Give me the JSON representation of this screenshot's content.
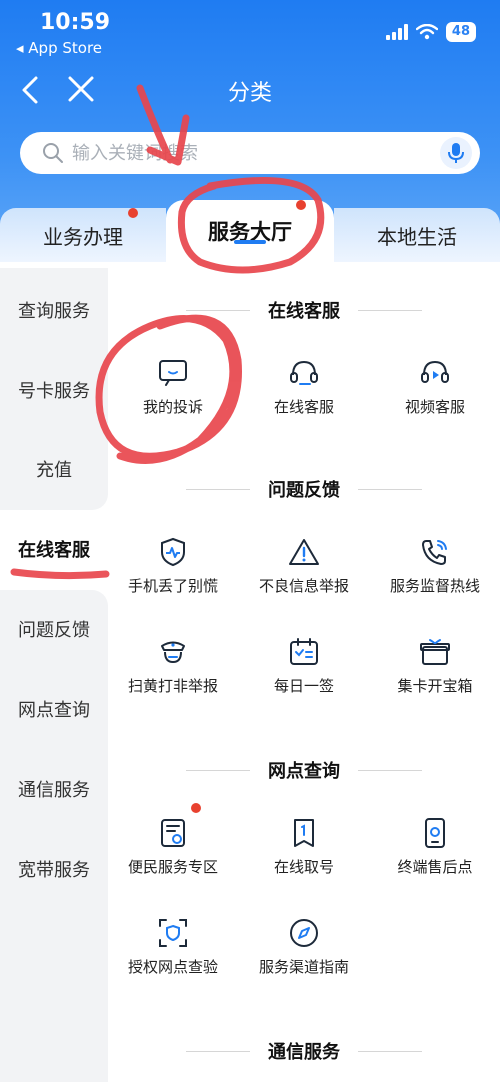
{
  "status_bar": {
    "time": "10:59",
    "back_app": "◂ App Store",
    "battery": "48"
  },
  "nav": {
    "title": "分类"
  },
  "search": {
    "placeholder": "输入关键词搜索"
  },
  "tabs": [
    {
      "label": "业务办理"
    },
    {
      "label": "服务大厅"
    },
    {
      "label": "本地生活"
    }
  ],
  "sidebar": {
    "items": [
      {
        "label": "查询服务"
      },
      {
        "label": "号卡服务"
      },
      {
        "label": "充值"
      },
      {
        "label": "在线客服"
      },
      {
        "label": "问题反馈"
      },
      {
        "label": "网点查询"
      },
      {
        "label": "通信服务"
      },
      {
        "label": "宽带服务"
      }
    ]
  },
  "sections": [
    {
      "title": "在线客服",
      "items": [
        {
          "label": "我的投诉",
          "icon": "chat-bubble-icon"
        },
        {
          "label": "在线客服",
          "icon": "headset-icon"
        },
        {
          "label": "视频客服",
          "icon": "video-headset-icon"
        }
      ]
    },
    {
      "title": "问题反馈",
      "items": [
        {
          "label": "手机丢了别慌",
          "icon": "shield-pulse-icon"
        },
        {
          "label": "不良信息举报",
          "icon": "warning-icon"
        },
        {
          "label": "服务监督热线",
          "icon": "phone-call-icon"
        },
        {
          "label": "扫黄打非举报",
          "icon": "police-icon"
        },
        {
          "label": "每日一签",
          "icon": "calendar-check-icon"
        },
        {
          "label": "集卡开宝箱",
          "icon": "gift-box-icon"
        }
      ]
    },
    {
      "title": "网点查询",
      "items": [
        {
          "label": "便民服务专区",
          "icon": "service-card-icon"
        },
        {
          "label": "在线取号",
          "icon": "queue-ticket-icon"
        },
        {
          "label": "终端售后点",
          "icon": "phone-repair-icon"
        },
        {
          "label": "授权网点查验",
          "icon": "scan-shield-icon"
        },
        {
          "label": "服务渠道指南",
          "icon": "compass-icon"
        }
      ]
    },
    {
      "title": "通信服务",
      "items": []
    }
  ],
  "colors": {
    "brand": "#1f7cf2",
    "badge": "#e8412f",
    "annotation": "#e8464d"
  }
}
